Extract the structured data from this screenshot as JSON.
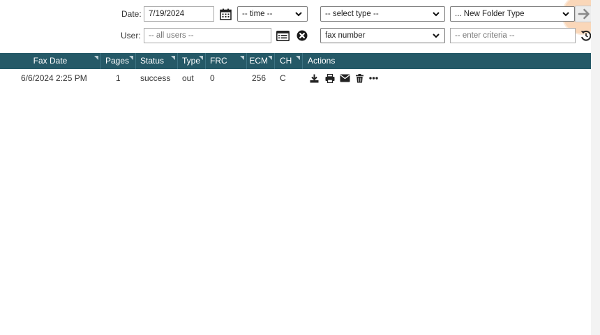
{
  "filters": {
    "date_label": "Date:",
    "date_value": "7/19/2024",
    "time_select": "-- time --",
    "type_select": "-- select type --",
    "folder_type_select": "... New Folder Type",
    "user_label": "User:",
    "user_placeholder": "-- all users --",
    "criteria_field_select": "fax number",
    "criteria_placeholder": "-- enter criteria --"
  },
  "table": {
    "columns": [
      "Fax Date",
      "Pages",
      "Status",
      "Type",
      "FRC",
      "ECM",
      "CH",
      "Actions"
    ],
    "rows": [
      {
        "fax_date": "6/6/2024 2:25 PM",
        "pages": "1",
        "status": "success",
        "type": "out",
        "frc": "0",
        "ecm": "256",
        "ch": "C"
      }
    ]
  },
  "icons": {
    "calendar": "calendar-icon",
    "user_list": "user-list-icon",
    "clear": "clear-circle-icon",
    "go": "arrow-right-icon",
    "reset": "refresh-icon",
    "actions": [
      "download-icon",
      "print-icon",
      "email-icon",
      "trash-icon",
      "more-icon"
    ]
  },
  "colors": {
    "header_bg": "#255967",
    "header_text": "#ffffff",
    "highlight": "#f5a664"
  }
}
